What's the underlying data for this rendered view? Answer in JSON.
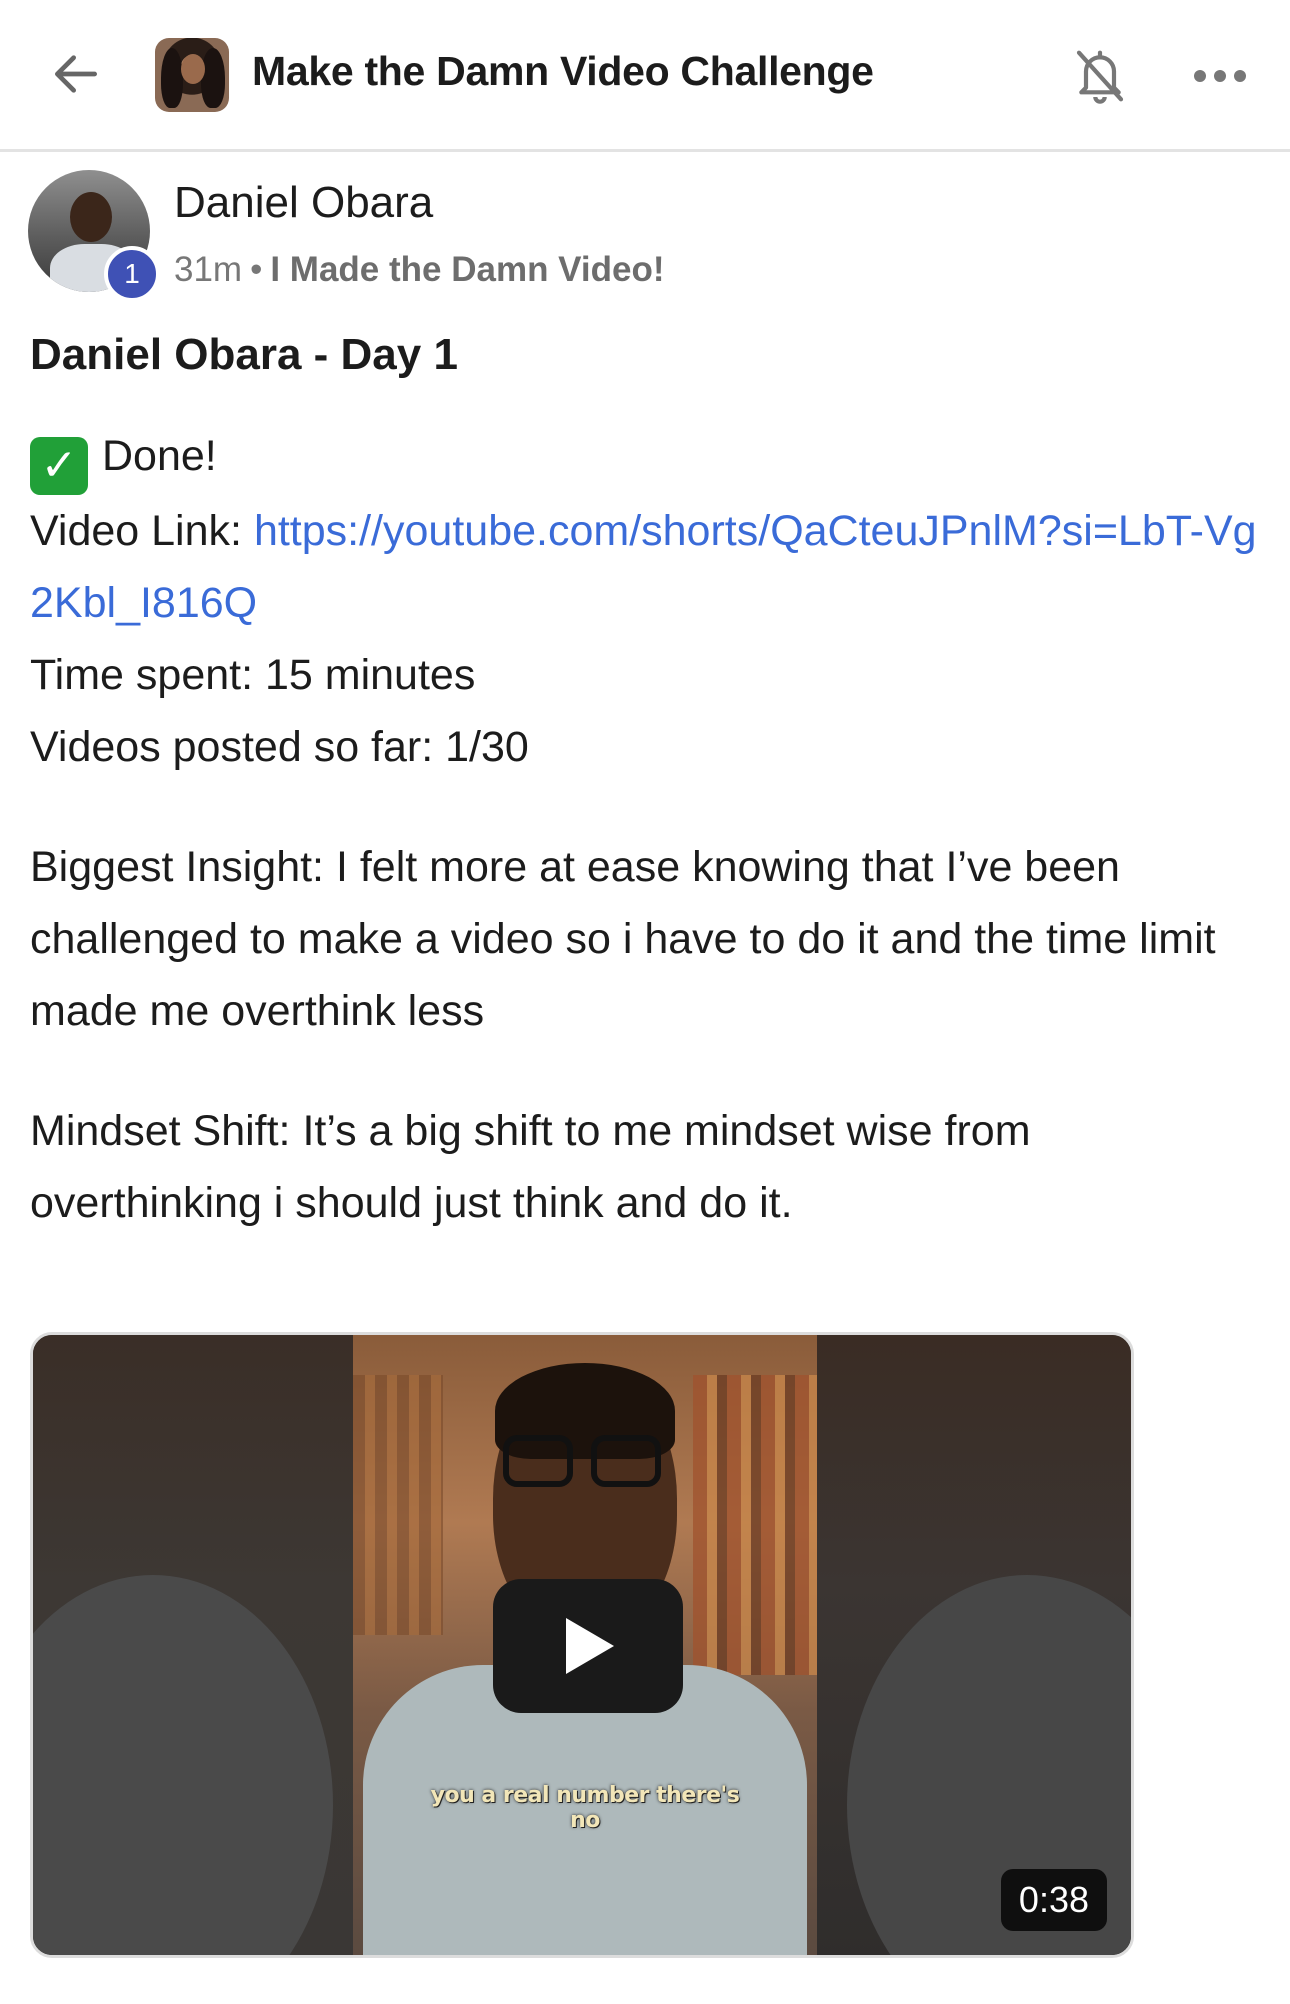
{
  "header": {
    "title": "Make the Damn Video Challenge",
    "back_icon": "arrow-left-icon",
    "bell_icon": "bell-off-icon",
    "more_icon": "more-horizontal-icon"
  },
  "post": {
    "author": "Daniel Obara",
    "level_badge": "1",
    "time": "31m",
    "separator": "•",
    "category": "I Made the Damn Video!",
    "title": "Daniel Obara - Day 1",
    "done_label": "Done!",
    "video_link_label": "Video Link: ",
    "video_link": "https://youtube.com/shorts/QaCteuJPnlM?si=LbT-Vg2Kbl_I816Q",
    "time_spent": "Time spent: 15 minutes",
    "videos_posted": "Videos posted so far: 1/30",
    "insight": "Biggest Insight: I felt more at ease knowing that I’ve been challenged to make a video so i have to do it and the time limit made me overthink less",
    "mindset": "Mindset Shift: It’s a big shift to me mindset wise from overthinking i should just think and do it."
  },
  "video": {
    "caption": "you a real number there's no",
    "duration": "0:38"
  },
  "colors": {
    "link": "#3a6bd8",
    "badge": "#3f51b5",
    "check": "#21a038"
  }
}
